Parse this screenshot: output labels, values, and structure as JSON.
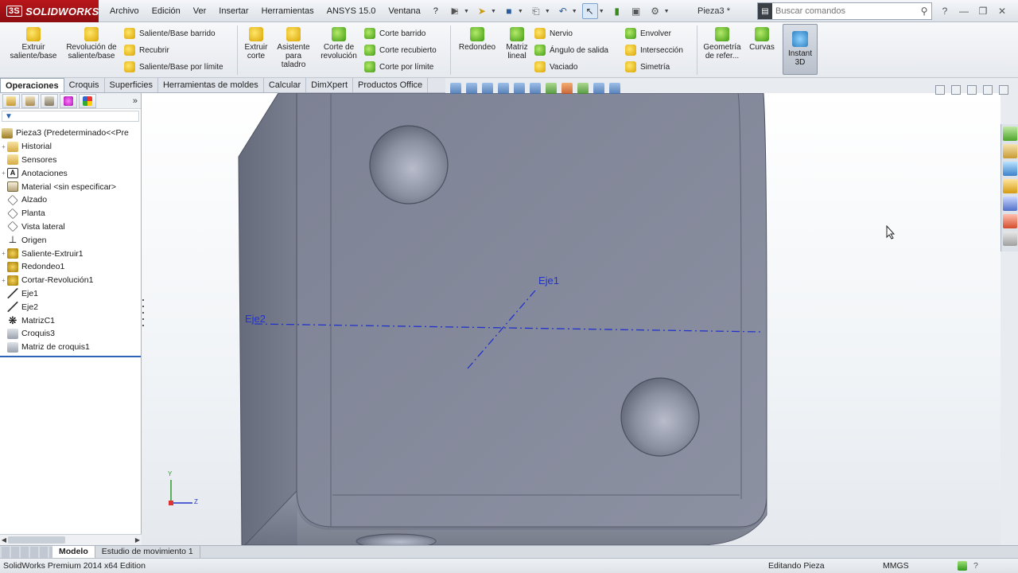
{
  "app": {
    "logo": "SOLIDWORKS",
    "doc_title": "Pieza3 *",
    "brand_color": "#b8161b"
  },
  "menu": [
    "Archivo",
    "Edición",
    "Ver",
    "Insertar",
    "Herramientas",
    "ANSYS 15.0",
    "Ventana",
    "?"
  ],
  "search": {
    "placeholder": "Buscar comandos"
  },
  "ribbon": {
    "extrude_boss": "Extruir saliente/base",
    "revolve_boss": "Revolución de saliente/base",
    "swept_boss": "Saliente/Base barrido",
    "lofted_boss": "Recubrir",
    "boundary_boss": "Saliente/Base por límite",
    "extrude_cut": "Extruir corte",
    "hole_wizard": "Asistente para taladro",
    "revolve_cut": "Corte de revolución",
    "swept_cut": "Corte barrido",
    "lofted_cut": "Corte recubierto",
    "boundary_cut": "Corte por límite",
    "fillet": "Redondeo",
    "linear_pattern": "Matriz lineal",
    "rib": "Nervio",
    "draft": "Ángulo de salida",
    "shell": "Vaciado",
    "wrap": "Envolver",
    "intersect": "Intersección",
    "mirror": "Simetría",
    "ref_geometry": "Geometría de refer...",
    "curves": "Curvas",
    "instant3d": "Instant 3D"
  },
  "tabs": [
    "Operaciones",
    "Croquis",
    "Superficies",
    "Herramientas de moldes",
    "Calcular",
    "DimXpert",
    "Productos Office"
  ],
  "active_tab": "Operaciones",
  "tree": [
    {
      "label": "Pieza3  (Predeterminado<<Pre",
      "icon": "part-icon",
      "exp": ""
    },
    {
      "label": "Historial",
      "icon": "folder-icon",
      "exp": "+"
    },
    {
      "label": "Sensores",
      "icon": "folder-icon",
      "exp": ""
    },
    {
      "label": "Anotaciones",
      "icon": "annotation-icon",
      "exp": "+"
    },
    {
      "label": "Material <sin especificar>",
      "icon": "material-icon",
      "exp": ""
    },
    {
      "label": "Alzado",
      "icon": "plane-icon",
      "exp": ""
    },
    {
      "label": "Planta",
      "icon": "plane-icon",
      "exp": ""
    },
    {
      "label": "Vista lateral",
      "icon": "plane-icon",
      "exp": ""
    },
    {
      "label": "Origen",
      "icon": "origin-icon",
      "exp": ""
    },
    {
      "label": "Saliente-Extruir1",
      "icon": "feature-icon",
      "exp": "+"
    },
    {
      "label": "Redondeo1",
      "icon": "feature-icon",
      "exp": ""
    },
    {
      "label": "Cortar-Revolución1",
      "icon": "feature-icon",
      "exp": "+"
    },
    {
      "label": "Eje1",
      "icon": "axis-icon",
      "exp": ""
    },
    {
      "label": "Eje2",
      "icon": "axis-icon",
      "exp": ""
    },
    {
      "label": "MatrizC1",
      "icon": "pattern-icon",
      "exp": ""
    },
    {
      "label": "Croquis3",
      "icon": "sketch-icon",
      "exp": ""
    },
    {
      "label": "Matriz de croquis1",
      "icon": "sketch-icon",
      "exp": ""
    }
  ],
  "viewport": {
    "axis1_label": "Eje1",
    "axis2_label": "Eje2",
    "axis_color": "#2233cc",
    "triad_y": "Y",
    "triad_z": "Z"
  },
  "bottom_tabs": [
    "Modelo",
    "Estudio de movimiento 1"
  ],
  "status": {
    "edition": "SolidWorks Premium 2014 x64 Edition",
    "mode": "Editando Pieza",
    "units": "MMGS"
  }
}
